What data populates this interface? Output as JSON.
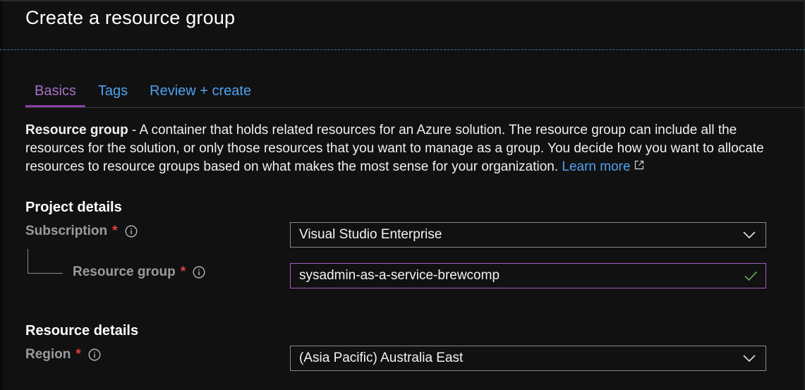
{
  "header": {
    "title": "Create a resource group"
  },
  "tabs": [
    {
      "label": "Basics",
      "active": true
    },
    {
      "label": "Tags",
      "active": false
    },
    {
      "label": "Review + create",
      "active": false
    }
  ],
  "description": {
    "lead": "Resource group",
    "text": " - A container that holds related resources for an Azure solution. The resource group can include all the resources for the solution, or only those resources that you want to manage as a group. You decide how you want to allocate resources to resource groups based on what makes the most sense for your organization. ",
    "link_label": "Learn more",
    "link_icon": "external-link-icon"
  },
  "project_details": {
    "title": "Project details",
    "subscription": {
      "label": "Subscription",
      "required_mark": "*",
      "value": "Visual Studio Enterprise",
      "icon": "chevron-down-icon"
    },
    "resource_group": {
      "label": "Resource group",
      "required_mark": "*",
      "value": "sysadmin-as-a-service-brewcomp",
      "icon": "checkmark-icon",
      "valid": true
    }
  },
  "resource_details": {
    "title": "Resource details",
    "region": {
      "label": "Region",
      "required_mark": "*",
      "value": "(Asia Pacific) Australia East",
      "icon": "chevron-down-icon"
    }
  },
  "colors": {
    "accent": "#8a3ea4",
    "link": "#4ea2ee",
    "required": "#e04040",
    "valid": "#57a64a",
    "background": "#111112"
  }
}
